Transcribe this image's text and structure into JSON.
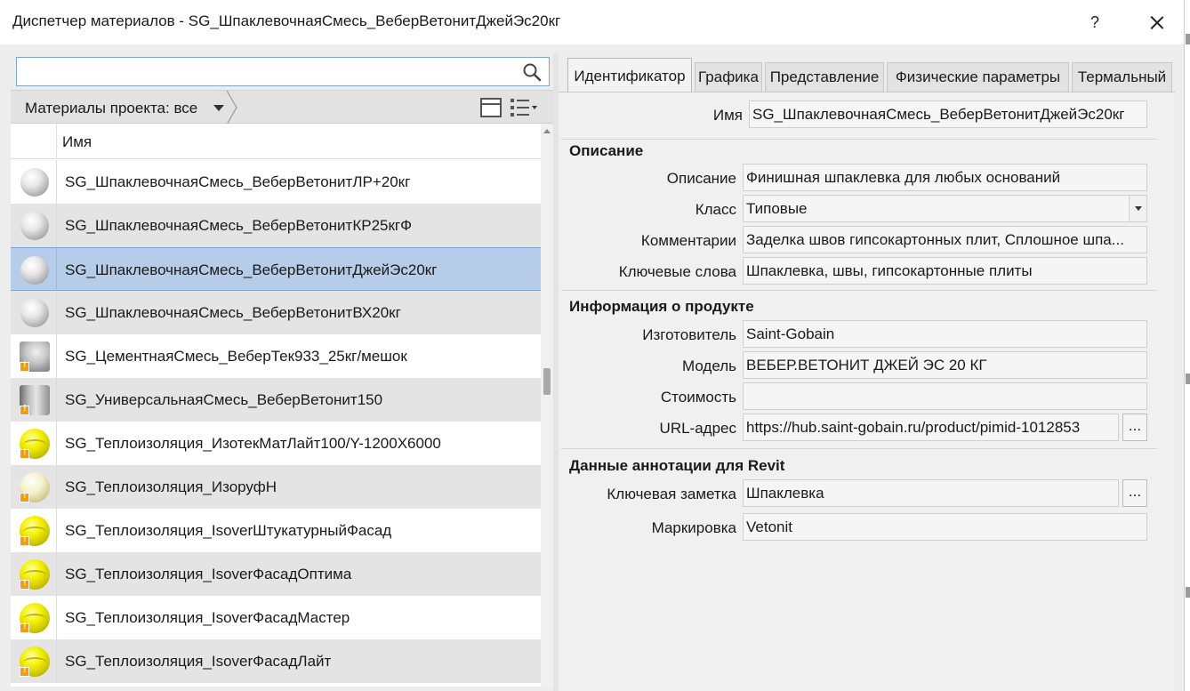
{
  "window": {
    "title": "Диспетчер материалов - SG_ШпаклевочнаяСмесь_ВеберВетонитДжейЭс20кг",
    "help_label": "?"
  },
  "left": {
    "search": {
      "value": "",
      "placeholder": ""
    },
    "filter_label": "Материалы проекта: все",
    "column_header": "Имя",
    "materials": [
      {
        "name": "SG_ШпаклевочнаяСмесь_ВеберВетонитЛР+20кг",
        "thumb": "white-sphere",
        "warning": false
      },
      {
        "name": "SG_ШпаклевочнаяСмесь_ВеберВетонитКР25кгФ",
        "thumb": "white-sphere",
        "warning": false
      },
      {
        "name": "SG_ШпаклевочнаяСмесь_ВеберВетонитДжейЭс20кг",
        "thumb": "white-sphere",
        "warning": false,
        "selected": true
      },
      {
        "name": "SG_ШпаклевочнаяСмесь_ВеберВетонитВХ20кг",
        "thumb": "white-sphere",
        "warning": false
      },
      {
        "name": "SG_ЦементнаяСмесь_ВеберТек933_25кг/мешок",
        "thumb": "gray-mesh",
        "warning": true
      },
      {
        "name": "SG_УниверсальнаяСмесь_ВеберВетонит150",
        "thumb": "gray-cylinder",
        "warning": true
      },
      {
        "name": "SG_Теплоизоляция_ИзотекМатЛайт100/Y-1200X6000",
        "thumb": "yellow-sphere",
        "warning": true
      },
      {
        "name": "SG_Теплоизоляция_ИзоруфН",
        "thumb": "pale-yellow-sphere",
        "warning": true
      },
      {
        "name": "SG_Теплоизоляция_IsoverШтукатурныйФасад",
        "thumb": "yellow-sphere",
        "warning": true
      },
      {
        "name": "SG_Теплоизоляция_IsoverФасадОптима",
        "thumb": "yellow-sphere",
        "warning": true
      },
      {
        "name": "SG_Теплоизоляция_IsoverФасадМастер",
        "thumb": "yellow-sphere",
        "warning": true
      },
      {
        "name": "SG_Теплоизоляция_IsoverФасадЛайт",
        "thumb": "yellow-sphere",
        "warning": true
      }
    ]
  },
  "right": {
    "tabs": [
      "Идентификатор",
      "Графика",
      "Представление",
      "Физические параметры",
      "Термальный"
    ],
    "active_tab": "Идентификатор",
    "name_label": "Имя",
    "name_value": "SG_ШпаклевочнаяСмесь_ВеберВетонитДжейЭс20кг",
    "sections": {
      "description": {
        "title": "Описание",
        "fields": {
          "description": {
            "label": "Описание",
            "value": "Финишная шпаклевка для любых оснований"
          },
          "class": {
            "label": "Класс",
            "value": "Типовые"
          },
          "comments": {
            "label": "Комментарии",
            "value": "Заделка швов гипсокартонных плит, Сплошное шпа..."
          },
          "keywords": {
            "label": "Ключевые слова",
            "value": "Шпаклевка, швы, гипсокартонные плиты"
          }
        }
      },
      "product": {
        "title": "Информация о продукте",
        "fields": {
          "manufacturer": {
            "label": "Изготовитель",
            "value": "Saint-Gobain"
          },
          "model": {
            "label": "Модель",
            "value": "ВЕБЕР.ВЕТОНИТ ДЖЕЙ ЭС 20 КГ"
          },
          "cost": {
            "label": "Стоимость",
            "value": ""
          },
          "url": {
            "label": "URL-адрес",
            "value": "https://hub.saint-gobain.ru/product/pimid-1012853"
          }
        }
      },
      "revit": {
        "title": "Данные аннотации для Revit",
        "fields": {
          "keynote": {
            "label": "Ключевая заметка",
            "value": "Шпаклевка"
          },
          "mark": {
            "label": "Маркировка",
            "value": "Vetonit"
          }
        }
      }
    },
    "browse_label": "..."
  }
}
